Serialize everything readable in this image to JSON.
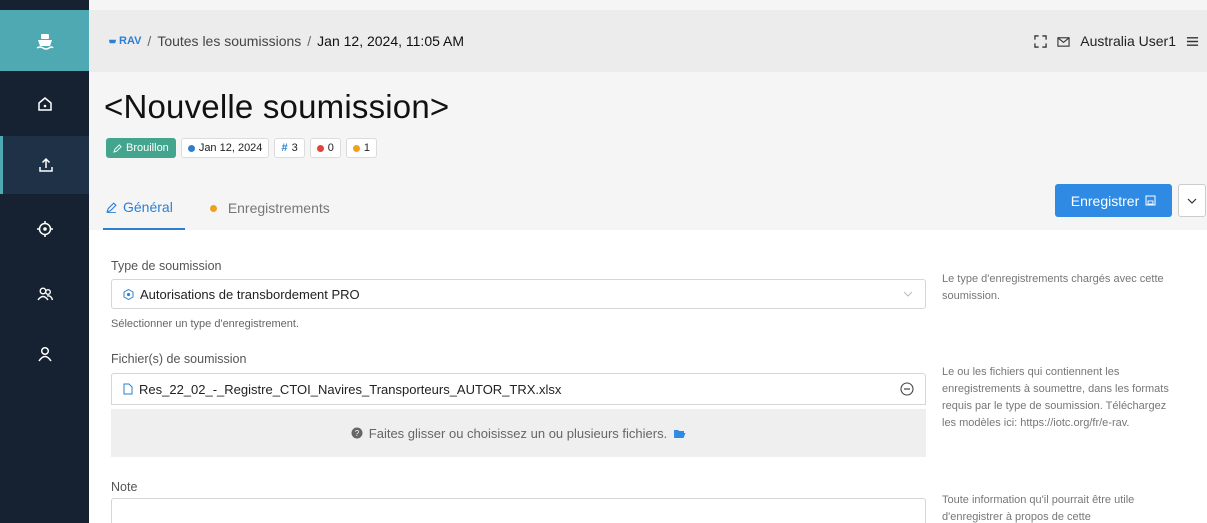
{
  "breadcrumb": {
    "app": "RAV",
    "sep1": "/",
    "section": "Toutes les soumissions",
    "sep2": "/",
    "current": "Jan 12, 2024, 11:05 AM"
  },
  "user": {
    "name": "Australia User1"
  },
  "title": "<Nouvelle soumission>",
  "badges": {
    "status": "Brouillon",
    "date": "Jan 12, 2024",
    "count": "3",
    "errors": "0",
    "warnings": "1"
  },
  "tabs": [
    {
      "label": "Général"
    },
    {
      "label": "Enregistrements"
    }
  ],
  "actions": {
    "save": "Enregistrer"
  },
  "form": {
    "type": {
      "label": "Type de soumission",
      "value": "Autorisations de transbordement PRO",
      "hint": "Sélectionner un type d'enregistrement.",
      "help": "Le type d'enregistrements chargés avec cette soumission."
    },
    "files": {
      "label": "Fichier(s) de soumission",
      "file_name": "Res_22_02_-_Registre_CTOI_Navires_Transporteurs_AUTOR_TRX.xlsx",
      "dropzone": "Faites glisser ou choisissez un ou plusieurs fichiers.",
      "help": "Le ou les fichiers qui contiennent les enregistrements à soumettre, dans les formats requis par le type de soumission. Téléchargez les modèles ici: https://iotc.org/fr/e-rav."
    },
    "note": {
      "label": "Note",
      "help": "Toute information qu'il pourrait être utile d'enregistrer à propos de cette"
    }
  },
  "colors": {
    "sidebar": "#162232",
    "accent": "#4fa9b3",
    "primary": "#2f8ae4",
    "draft": "#43a58e"
  }
}
